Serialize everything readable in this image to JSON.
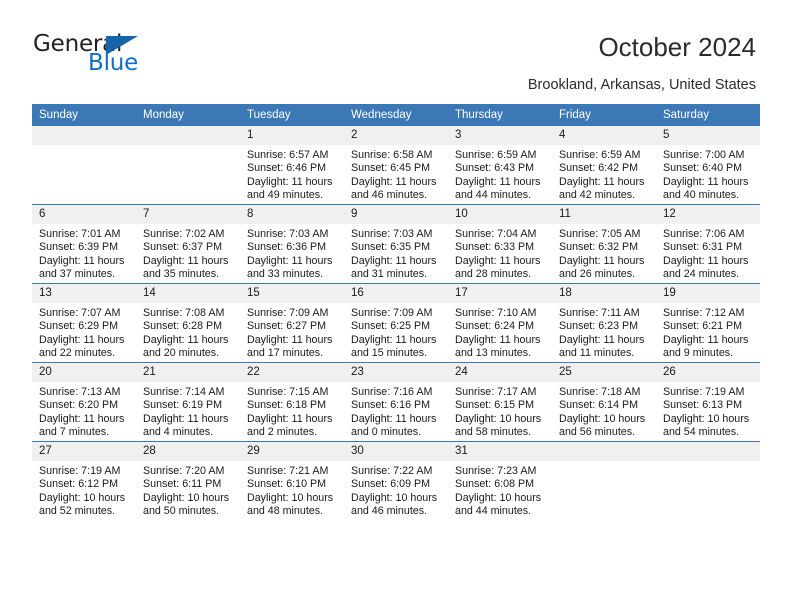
{
  "logo": {
    "word1": "General",
    "word2": "Blue",
    "triangle_color": "#1565a8",
    "blue_text_color": "#0f6fc5"
  },
  "header": {
    "title": "October 2024",
    "location": "Brookland, Arkansas, United States",
    "accent_color": "#3b78b5",
    "daynum_bg": "#f0f0f0"
  },
  "weekdays": [
    "Sunday",
    "Monday",
    "Tuesday",
    "Wednesday",
    "Thursday",
    "Friday",
    "Saturday"
  ],
  "labels": {
    "sunrise_prefix": "Sunrise:",
    "sunset_prefix": "Sunset:",
    "daylight_prefix": "Daylight:"
  },
  "weeks": [
    [
      {
        "day": "",
        "empty": true
      },
      {
        "day": "",
        "empty": true
      },
      {
        "day": "1",
        "sunrise": "Sunrise: 6:57 AM",
        "sunset": "Sunset: 6:46 PM",
        "daylight": "Daylight: 11 hours and 49 minutes."
      },
      {
        "day": "2",
        "sunrise": "Sunrise: 6:58 AM",
        "sunset": "Sunset: 6:45 PM",
        "daylight": "Daylight: 11 hours and 46 minutes."
      },
      {
        "day": "3",
        "sunrise": "Sunrise: 6:59 AM",
        "sunset": "Sunset: 6:43 PM",
        "daylight": "Daylight: 11 hours and 44 minutes."
      },
      {
        "day": "4",
        "sunrise": "Sunrise: 6:59 AM",
        "sunset": "Sunset: 6:42 PM",
        "daylight": "Daylight: 11 hours and 42 minutes."
      },
      {
        "day": "5",
        "sunrise": "Sunrise: 7:00 AM",
        "sunset": "Sunset: 6:40 PM",
        "daylight": "Daylight: 11 hours and 40 minutes."
      }
    ],
    [
      {
        "day": "6",
        "sunrise": "Sunrise: 7:01 AM",
        "sunset": "Sunset: 6:39 PM",
        "daylight": "Daylight: 11 hours and 37 minutes."
      },
      {
        "day": "7",
        "sunrise": "Sunrise: 7:02 AM",
        "sunset": "Sunset: 6:37 PM",
        "daylight": "Daylight: 11 hours and 35 minutes."
      },
      {
        "day": "8",
        "sunrise": "Sunrise: 7:03 AM",
        "sunset": "Sunset: 6:36 PM",
        "daylight": "Daylight: 11 hours and 33 minutes."
      },
      {
        "day": "9",
        "sunrise": "Sunrise: 7:03 AM",
        "sunset": "Sunset: 6:35 PM",
        "daylight": "Daylight: 11 hours and 31 minutes."
      },
      {
        "day": "10",
        "sunrise": "Sunrise: 7:04 AM",
        "sunset": "Sunset: 6:33 PM",
        "daylight": "Daylight: 11 hours and 28 minutes."
      },
      {
        "day": "11",
        "sunrise": "Sunrise: 7:05 AM",
        "sunset": "Sunset: 6:32 PM",
        "daylight": "Daylight: 11 hours and 26 minutes."
      },
      {
        "day": "12",
        "sunrise": "Sunrise: 7:06 AM",
        "sunset": "Sunset: 6:31 PM",
        "daylight": "Daylight: 11 hours and 24 minutes."
      }
    ],
    [
      {
        "day": "13",
        "sunrise": "Sunrise: 7:07 AM",
        "sunset": "Sunset: 6:29 PM",
        "daylight": "Daylight: 11 hours and 22 minutes."
      },
      {
        "day": "14",
        "sunrise": "Sunrise: 7:08 AM",
        "sunset": "Sunset: 6:28 PM",
        "daylight": "Daylight: 11 hours and 20 minutes."
      },
      {
        "day": "15",
        "sunrise": "Sunrise: 7:09 AM",
        "sunset": "Sunset: 6:27 PM",
        "daylight": "Daylight: 11 hours and 17 minutes."
      },
      {
        "day": "16",
        "sunrise": "Sunrise: 7:09 AM",
        "sunset": "Sunset: 6:25 PM",
        "daylight": "Daylight: 11 hours and 15 minutes."
      },
      {
        "day": "17",
        "sunrise": "Sunrise: 7:10 AM",
        "sunset": "Sunset: 6:24 PM",
        "daylight": "Daylight: 11 hours and 13 minutes."
      },
      {
        "day": "18",
        "sunrise": "Sunrise: 7:11 AM",
        "sunset": "Sunset: 6:23 PM",
        "daylight": "Daylight: 11 hours and 11 minutes."
      },
      {
        "day": "19",
        "sunrise": "Sunrise: 7:12 AM",
        "sunset": "Sunset: 6:21 PM",
        "daylight": "Daylight: 11 hours and 9 minutes."
      }
    ],
    [
      {
        "day": "20",
        "sunrise": "Sunrise: 7:13 AM",
        "sunset": "Sunset: 6:20 PM",
        "daylight": "Daylight: 11 hours and 7 minutes."
      },
      {
        "day": "21",
        "sunrise": "Sunrise: 7:14 AM",
        "sunset": "Sunset: 6:19 PM",
        "daylight": "Daylight: 11 hours and 4 minutes."
      },
      {
        "day": "22",
        "sunrise": "Sunrise: 7:15 AM",
        "sunset": "Sunset: 6:18 PM",
        "daylight": "Daylight: 11 hours and 2 minutes."
      },
      {
        "day": "23",
        "sunrise": "Sunrise: 7:16 AM",
        "sunset": "Sunset: 6:16 PM",
        "daylight": "Daylight: 11 hours and 0 minutes."
      },
      {
        "day": "24",
        "sunrise": "Sunrise: 7:17 AM",
        "sunset": "Sunset: 6:15 PM",
        "daylight": "Daylight: 10 hours and 58 minutes."
      },
      {
        "day": "25",
        "sunrise": "Sunrise: 7:18 AM",
        "sunset": "Sunset: 6:14 PM",
        "daylight": "Daylight: 10 hours and 56 minutes."
      },
      {
        "day": "26",
        "sunrise": "Sunrise: 7:19 AM",
        "sunset": "Sunset: 6:13 PM",
        "daylight": "Daylight: 10 hours and 54 minutes."
      }
    ],
    [
      {
        "day": "27",
        "sunrise": "Sunrise: 7:19 AM",
        "sunset": "Sunset: 6:12 PM",
        "daylight": "Daylight: 10 hours and 52 minutes."
      },
      {
        "day": "28",
        "sunrise": "Sunrise: 7:20 AM",
        "sunset": "Sunset: 6:11 PM",
        "daylight": "Daylight: 10 hours and 50 minutes."
      },
      {
        "day": "29",
        "sunrise": "Sunrise: 7:21 AM",
        "sunset": "Sunset: 6:10 PM",
        "daylight": "Daylight: 10 hours and 48 minutes."
      },
      {
        "day": "30",
        "sunrise": "Sunrise: 7:22 AM",
        "sunset": "Sunset: 6:09 PM",
        "daylight": "Daylight: 10 hours and 46 minutes."
      },
      {
        "day": "31",
        "sunrise": "Sunrise: 7:23 AM",
        "sunset": "Sunset: 6:08 PM",
        "daylight": "Daylight: 10 hours and 44 minutes."
      },
      {
        "day": "",
        "empty": true
      },
      {
        "day": "",
        "empty": true
      }
    ]
  ]
}
